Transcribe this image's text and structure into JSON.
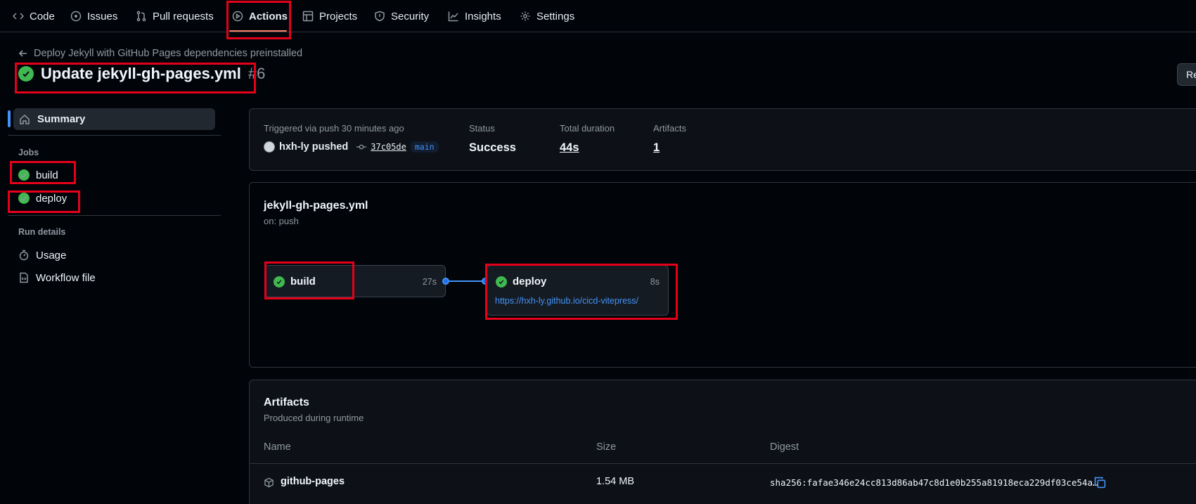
{
  "nav": {
    "code": "Code",
    "issues": "Issues",
    "pulls": "Pull requests",
    "actions": "Actions",
    "projects": "Projects",
    "security": "Security",
    "insights": "Insights",
    "settings": "Settings"
  },
  "header": {
    "back_label": "Deploy Jekyll with GitHub Pages dependencies preinstalled",
    "title": "Update jekyll-gh-pages.yml",
    "run_number": "#6",
    "rerun_label": "Re"
  },
  "sidebar": {
    "summary": "Summary",
    "jobs_heading": "Jobs",
    "jobs": [
      "build",
      "deploy"
    ],
    "run_details_heading": "Run details",
    "usage": "Usage",
    "workflow_file": "Workflow file"
  },
  "summary": {
    "trigger_label": "Triggered via push 30 minutes ago",
    "actor": "hxh-ly pushed",
    "commit": "37c05de",
    "branch": "main",
    "status_label": "Status",
    "status_value": "Success",
    "duration_label": "Total duration",
    "duration_value": "44s",
    "artifacts_label": "Artifacts",
    "artifacts_value": "1"
  },
  "workflow": {
    "file": "jekyll-gh-pages.yml",
    "trigger": "on: push",
    "build": {
      "name": "build",
      "duration": "27s"
    },
    "deploy": {
      "name": "deploy",
      "duration": "8s",
      "url": "https://hxh-ly.github.io/cicd-vitepress/"
    }
  },
  "artifacts": {
    "title": "Artifacts",
    "subtitle": "Produced during runtime",
    "columns": [
      "Name",
      "Size",
      "Digest"
    ],
    "rows": [
      {
        "name": "github-pages",
        "size": "1.54 MB",
        "digest": "sha256:fafae346e24cc813d86ab47c8d1e0b255a81918eca229df03ce54a…"
      }
    ]
  },
  "colors": {
    "success": "#3fb950",
    "accent": "#4493f8",
    "highlight": "#e5001a"
  }
}
